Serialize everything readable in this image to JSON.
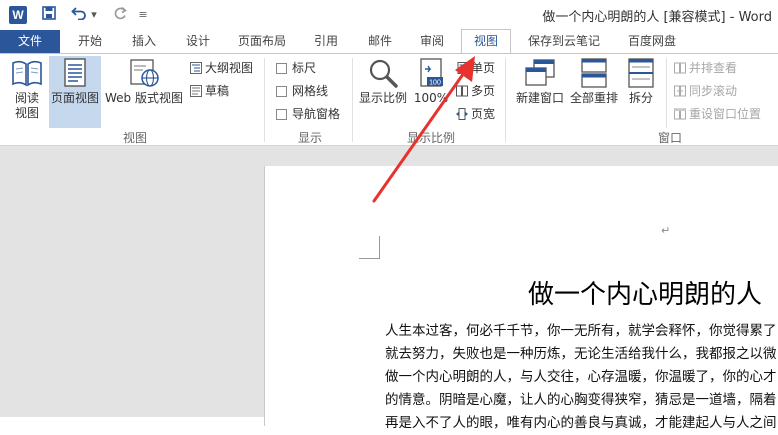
{
  "app": {
    "logo": "W",
    "title": "做一个内心明朗的人 [兼容模式] - Word"
  },
  "quick_access": {
    "save_icon": "save-icon",
    "undo_icon": "undo-icon",
    "redo_icon": "redo-icon",
    "undo_dropdown_glyph": "▾",
    "customize_glyph": "≡"
  },
  "tabs": [
    "文件",
    "开始",
    "插入",
    "设计",
    "页面布局",
    "引用",
    "邮件",
    "审阅",
    "视图",
    "保存到云笔记",
    "百度网盘"
  ],
  "active_tab": "视图",
  "ribbon": {
    "views": {
      "label": "视图",
      "read_mode": [
        "阅读",
        "视图"
      ],
      "print_layout": "页面视图",
      "web_layout": "Web 版式视图",
      "outline": "大纲视图",
      "draft": "草稿"
    },
    "show": {
      "label": "显示",
      "ruler": "标尺",
      "gridlines": "网格线",
      "nav_pane": "导航窗格"
    },
    "zoom": {
      "label": "显示比例",
      "zoom_btn": "显示比例",
      "hundred": "100%",
      "hundred_badge": "100",
      "one_page": "单页",
      "multi_page": "多页",
      "page_width": "页宽"
    },
    "window": {
      "label": "窗口",
      "new_window": "新建窗口",
      "arrange_all": "全部重排",
      "split": "拆分",
      "side_by_side": "并排查看",
      "sync_scroll": "同步滚动",
      "reset_position": "重设窗口位置"
    }
  },
  "document": {
    "paragraph_mark": "↵",
    "heading": "做一个内心明朗的人",
    "lines": [
      "人生本过客，何必千千节，你一无所有，就学会释怀，你觉得累了",
      "就去努力，失败也是一种历炼，无论生活给我什么，我都报之以微",
      "做一个内心明朗的人，与人交往，心存温暖，你温暖了，你的心才",
      "的情意。阴暗是心魔，让人的心胸变得狭窄，猜忌是一道墙，隔着",
      "再是入不了人的眼，唯有内心的善良与真诚，才能建起人与人之间"
    ]
  },
  "colors": {
    "accent": "#2b579a",
    "arrow": "#e8322e",
    "selected_view": "#c5d8ee"
  }
}
